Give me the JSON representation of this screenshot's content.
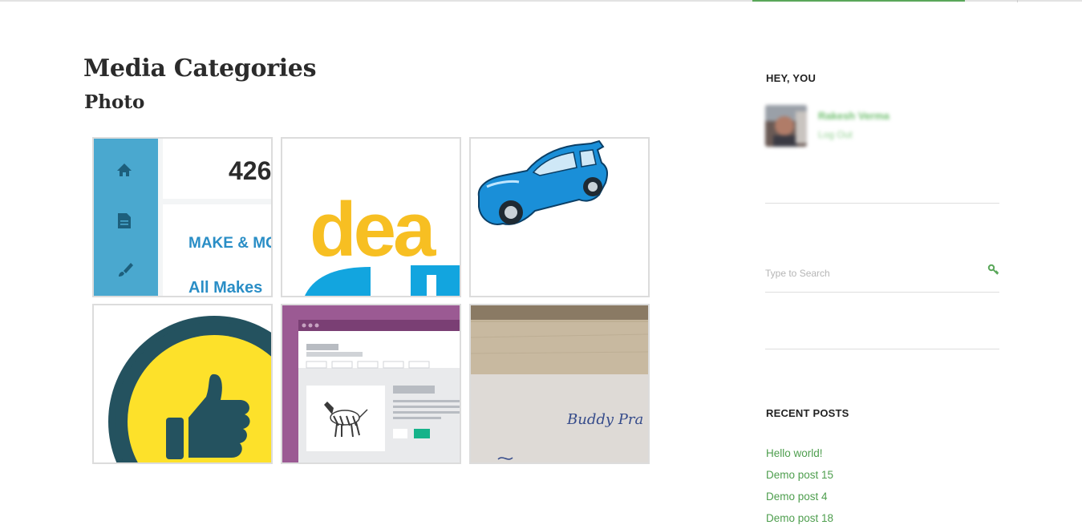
{
  "page": {
    "title": "Media Categories",
    "subtitle": "Photo"
  },
  "gallery": {
    "thumbnails": [
      {
        "icon": "dashboard-screenshot",
        "text_big": "426",
        "text_make": "MAKE & MO",
        "text_all": "All Makes"
      },
      {
        "icon": "logo-crop",
        "text": "dea"
      },
      {
        "icon": "blue-car"
      },
      {
        "icon": "thumbs-up-badge"
      },
      {
        "icon": "zebra-browser-window"
      },
      {
        "icon": "handwritten-note",
        "text": "Buddy Pra"
      }
    ]
  },
  "sidebar": {
    "user_widget": {
      "title": "HEY, YOU",
      "user_name": "Rakesh Verma",
      "logout_label": "Log Out"
    },
    "search": {
      "placeholder": "Type to Search",
      "icon": "search-key-icon"
    },
    "recent_posts": {
      "title": "RECENT POSTS",
      "items": [
        "Hello world!",
        "Demo post 15",
        "Demo post 4",
        "Demo post 18"
      ]
    }
  },
  "colors": {
    "link_green": "#4e9e4e",
    "accent_green": "#5aa75a",
    "thumb_border": "#dcdcdc"
  }
}
